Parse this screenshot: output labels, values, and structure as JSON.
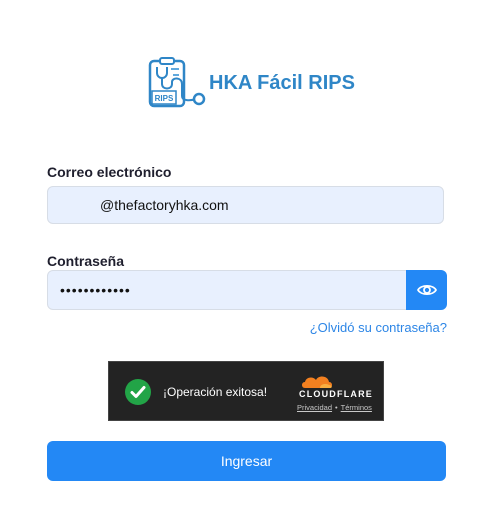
{
  "app": {
    "title": "HKA Fácil RIPS",
    "logo_badge": "RIPS"
  },
  "colors": {
    "brand": "#2f86c7",
    "primary_button": "#2388f5",
    "link": "#2d86e6"
  },
  "form": {
    "email_label": "Correo electrónico",
    "email_value": "@thefactoryhka.com",
    "password_label": "Contraseña",
    "password_value": "••••••••••••",
    "forgot_link": "¿Olvidó su contraseña?",
    "submit_label": "Ingresar"
  },
  "captcha": {
    "status": "¡Operación exitosa!",
    "brand": "CLOUDFLARE",
    "privacy": "Privacidad",
    "separator": "•",
    "terms": "Términos"
  },
  "icons": {
    "toggle_password": "eye-icon",
    "success": "check-circle-icon"
  }
}
